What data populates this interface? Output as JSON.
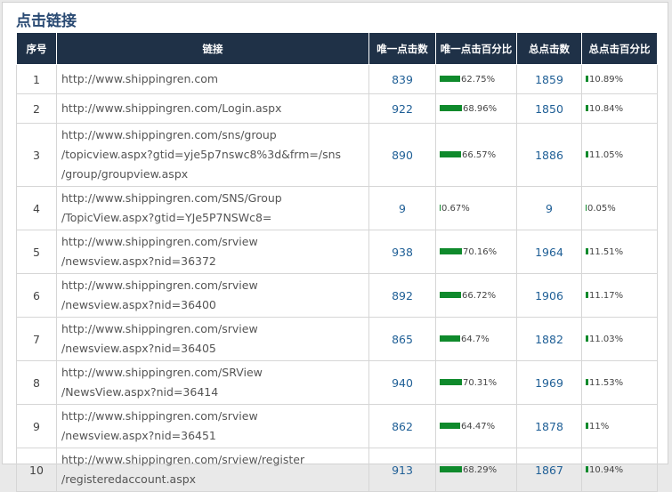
{
  "title": "点击链接",
  "headers": {
    "index": "序号",
    "link": "链接",
    "unique_clicks": "唯一点击数",
    "unique_pct": "唯一点击百分比",
    "total_clicks": "总点击数",
    "total_pct": "总点击百分比"
  },
  "colors": {
    "header_bg": "#1f3147",
    "bar": "#0f8a2c",
    "number": "#1f5f96"
  },
  "rows": [
    {
      "index": "1",
      "link": [
        "http://www.shippingren.com"
      ],
      "unique": "839",
      "unique_pct_text": "62.75%",
      "unique_pct": 62.75,
      "total": "1859",
      "total_pct_text": "10.89%",
      "total_pct": 10.89
    },
    {
      "index": "2",
      "link": [
        "http://www.shippingren.com/Login.aspx"
      ],
      "unique": "922",
      "unique_pct_text": "68.96%",
      "unique_pct": 68.96,
      "total": "1850",
      "total_pct_text": "10.84%",
      "total_pct": 10.84
    },
    {
      "index": "3",
      "link": [
        "http://www.shippingren.com/sns/group",
        "/topicview.aspx?gtid=yje5p7nswc8%3d&frm=/sns",
        "/group/groupview.aspx"
      ],
      "unique": "890",
      "unique_pct_text": "66.57%",
      "unique_pct": 66.57,
      "total": "1886",
      "total_pct_text": "11.05%",
      "total_pct": 11.05
    },
    {
      "index": "4",
      "link": [
        "http://www.shippingren.com/SNS/Group",
        "/TopicView.aspx?gtid=YJe5P7NSWc8="
      ],
      "unique": "9",
      "unique_pct_text": "0.67%",
      "unique_pct": 0.67,
      "total": "9",
      "total_pct_text": "0.05%",
      "total_pct": 0.05
    },
    {
      "index": "5",
      "link": [
        "http://www.shippingren.com/srview",
        "/newsview.aspx?nid=36372"
      ],
      "unique": "938",
      "unique_pct_text": "70.16%",
      "unique_pct": 70.16,
      "total": "1964",
      "total_pct_text": "11.51%",
      "total_pct": 11.51
    },
    {
      "index": "6",
      "link": [
        "http://www.shippingren.com/srview",
        "/newsview.aspx?nid=36400"
      ],
      "unique": "892",
      "unique_pct_text": "66.72%",
      "unique_pct": 66.72,
      "total": "1906",
      "total_pct_text": "11.17%",
      "total_pct": 11.17
    },
    {
      "index": "7",
      "link": [
        "http://www.shippingren.com/srview",
        "/newsview.aspx?nid=36405"
      ],
      "unique": "865",
      "unique_pct_text": "64.7%",
      "unique_pct": 64.7,
      "total": "1882",
      "total_pct_text": "11.03%",
      "total_pct": 11.03
    },
    {
      "index": "8",
      "link": [
        "http://www.shippingren.com/SRView",
        "/NewsView.aspx?nid=36414"
      ],
      "unique": "940",
      "unique_pct_text": "70.31%",
      "unique_pct": 70.31,
      "total": "1969",
      "total_pct_text": "11.53%",
      "total_pct": 11.53
    },
    {
      "index": "9",
      "link": [
        "http://www.shippingren.com/srview",
        "/newsview.aspx?nid=36451"
      ],
      "unique": "862",
      "unique_pct_text": "64.47%",
      "unique_pct": 64.47,
      "total": "1878",
      "total_pct_text": "11%",
      "total_pct": 11
    },
    {
      "index": "10",
      "link": [
        "http://www.shippingren.com/srview/register",
        "/registeredaccount.aspx"
      ],
      "unique": "913",
      "unique_pct_text": "68.29%",
      "unique_pct": 68.29,
      "total": "1867",
      "total_pct_text": "10.94%",
      "total_pct": 10.94
    }
  ]
}
